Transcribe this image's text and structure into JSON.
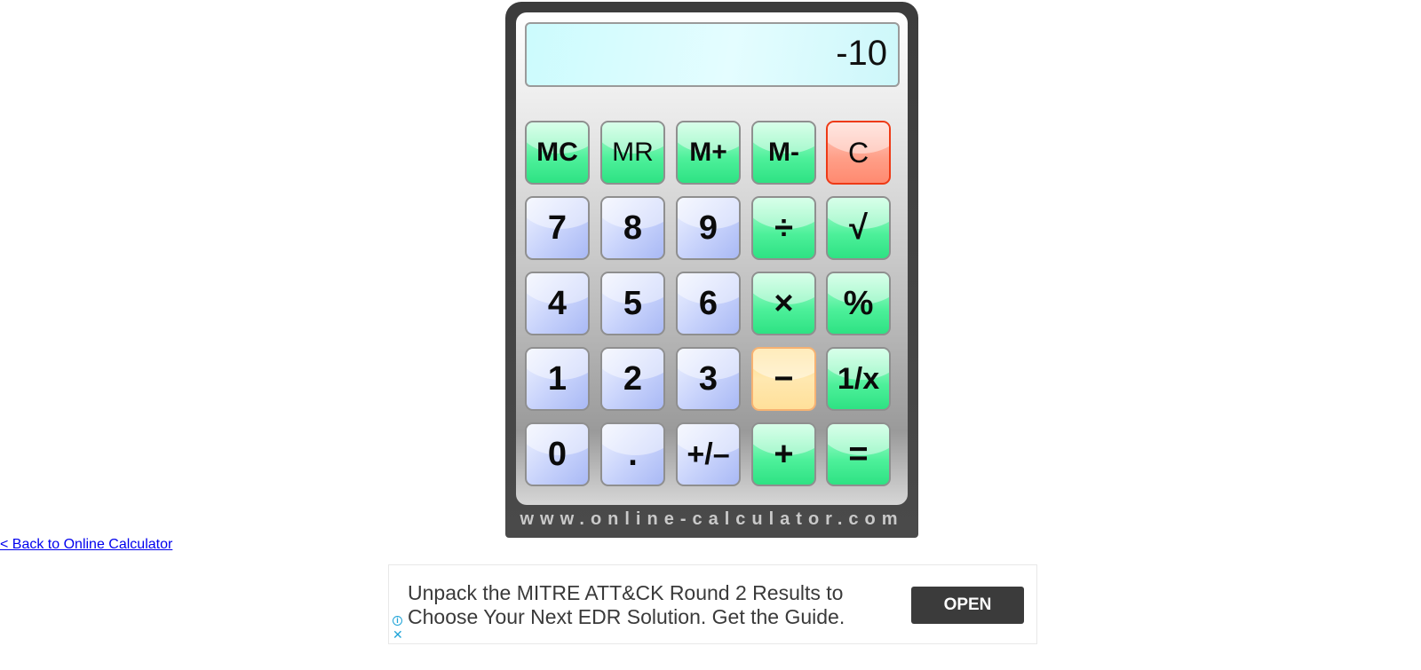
{
  "calculator": {
    "display_value": "-10",
    "site_label": "www.online-calculator.com",
    "keys": {
      "mc": "MC",
      "mr": "MR",
      "mplus": "M+",
      "mminus": "M-",
      "clear": "C",
      "seven": "7",
      "eight": "8",
      "nine": "9",
      "divide": "÷",
      "sqrt": "√",
      "four": "4",
      "five": "5",
      "six": "6",
      "multiply": "×",
      "percent": "%",
      "one": "1",
      "two": "2",
      "three": "3",
      "minus": "−",
      "reciprocal": "1/x",
      "zero": "0",
      "decimal": ".",
      "sign": "+/–",
      "plus": "+",
      "equals": "="
    },
    "active_key": "minus"
  },
  "links": {
    "back": "< Back to Online Calculator"
  },
  "ad": {
    "text": "Unpack the MITRE ATT&CK Round 2 Results to Choose Your Next EDR Solution. Get the Guide.",
    "button_label": "OPEN",
    "info_symbol": "i",
    "close_symbol": "✕"
  }
}
